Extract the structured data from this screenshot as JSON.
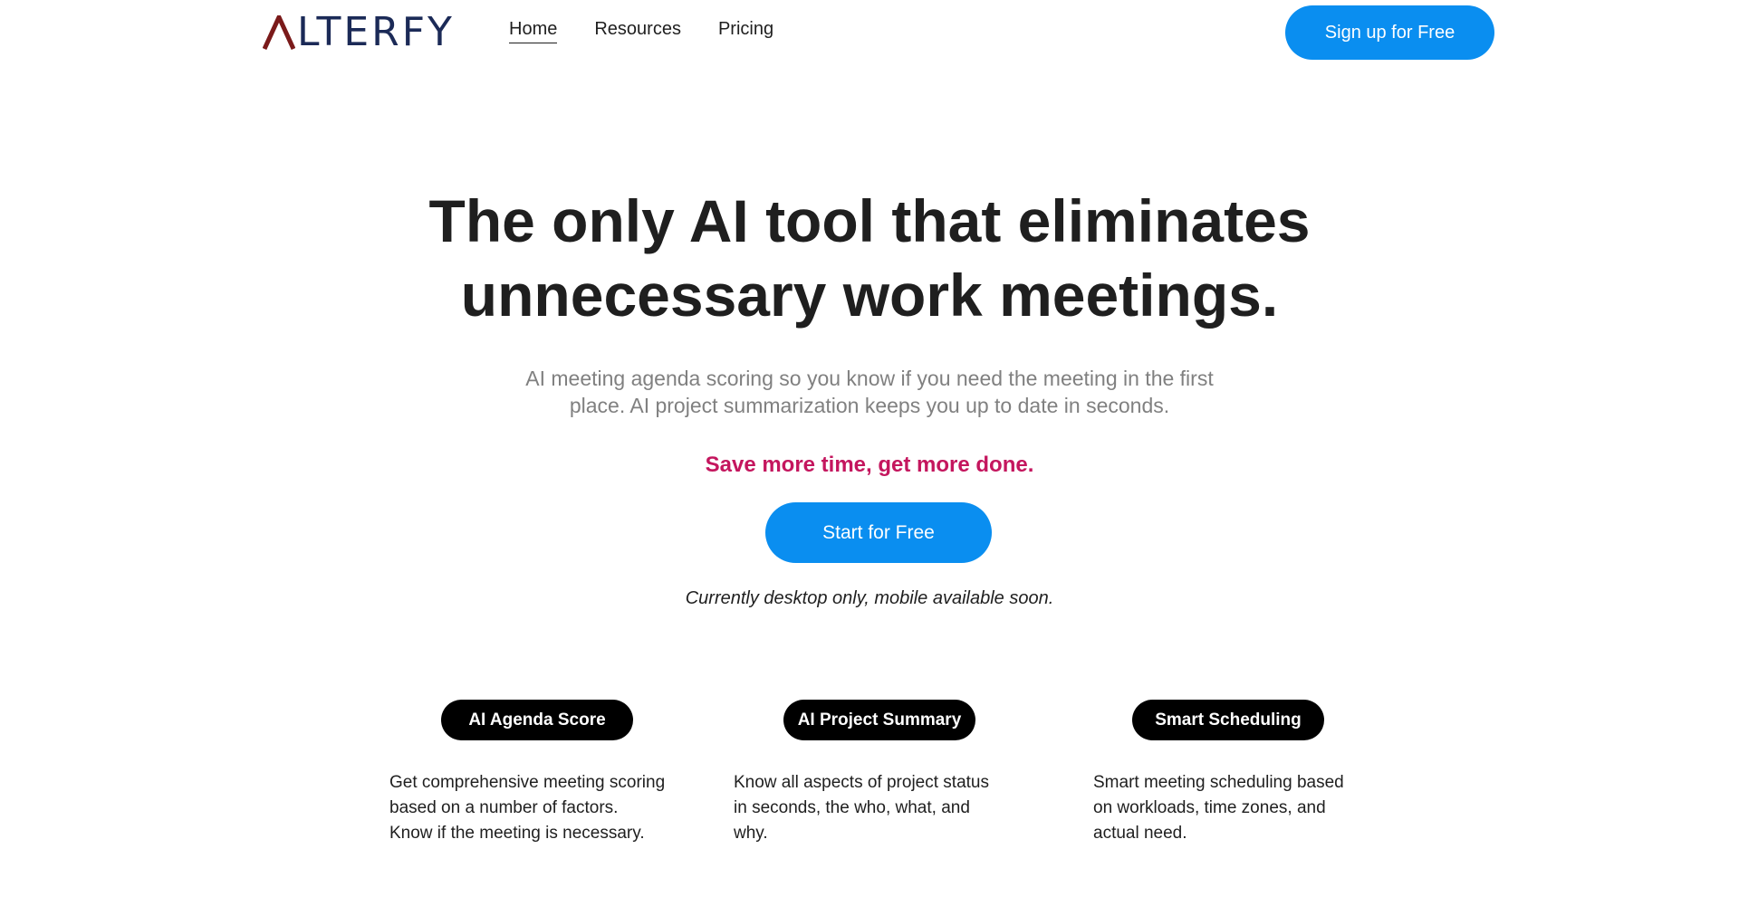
{
  "brand": {
    "logo_text": "LTERFY",
    "logo_mark_color": "#7a1a1a",
    "logo_text_color": "#1b2a57"
  },
  "nav": {
    "items": [
      {
        "label": "Home",
        "active": true
      },
      {
        "label": "Resources",
        "active": false
      },
      {
        "label": "Pricing",
        "active": false
      }
    ]
  },
  "header": {
    "signup_label": "Sign up for Free"
  },
  "hero": {
    "title_line1": "The only AI tool that eliminates",
    "title_line2": "unnecessary work meetings.",
    "subtitle_line1": "AI meeting agenda scoring so you know if you need the meeting in the first",
    "subtitle_line2": "place. AI project summarization keeps you up to date in seconds.",
    "tagline": "Save more time, get more done.",
    "cta_label": "Start for Free",
    "note": "Currently desktop only, mobile available soon."
  },
  "features": [
    {
      "title": "AI Agenda Score",
      "desc_line1": "Get comprehensive meeting scoring",
      "desc_line2": "based on a number of factors.",
      "desc_line3": "Know if the meeting is necessary."
    },
    {
      "title": "AI Project Summary",
      "desc_line1": "Know all aspects of project status",
      "desc_line2": "in seconds, the who, what, and",
      "desc_line3": "why."
    },
    {
      "title": "Smart Scheduling",
      "desc_line1": "Smart meeting scheduling based",
      "desc_line2": "on workloads, time zones, and",
      "desc_line3": "actual need."
    }
  ],
  "colors": {
    "accent_blue": "#0a8ef0",
    "tagline_pink": "#c4165e",
    "pill_black": "#000000"
  }
}
